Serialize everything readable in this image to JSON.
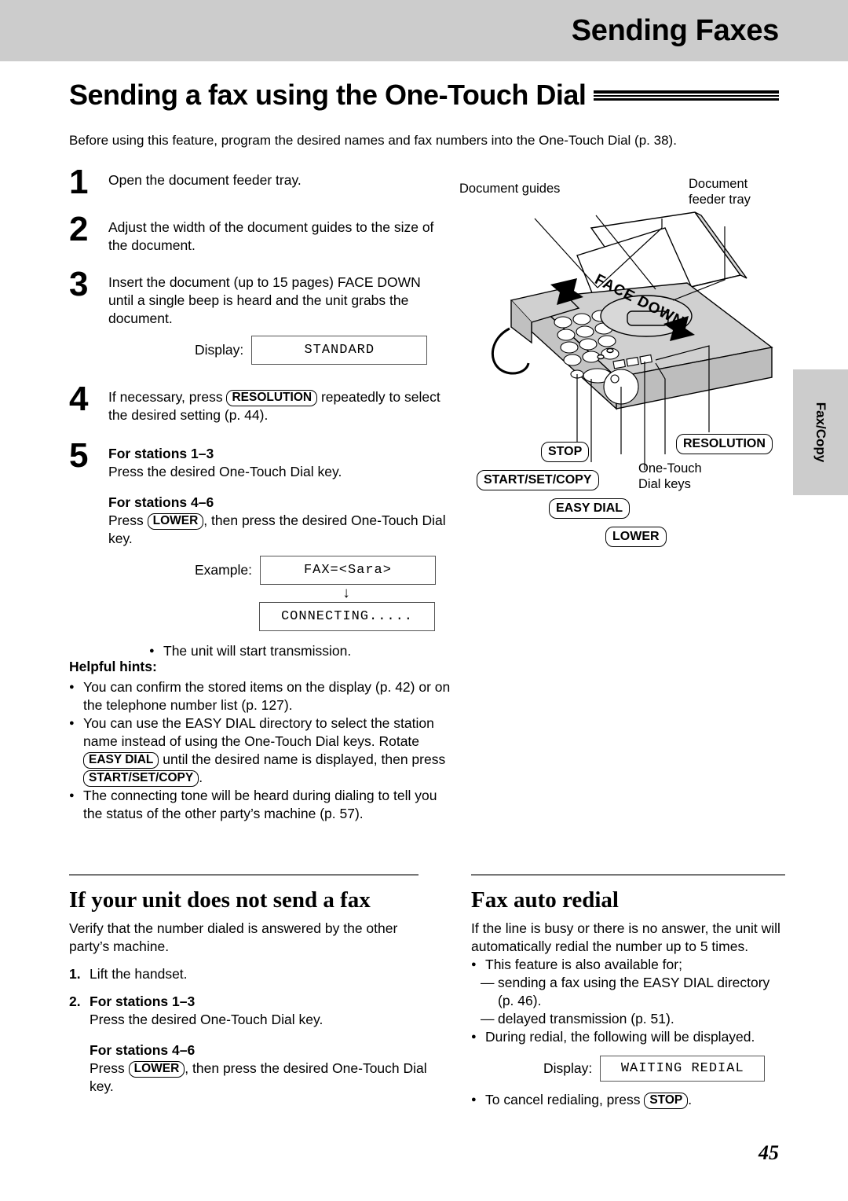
{
  "header": {
    "section_title": "Sending Faxes"
  },
  "title": {
    "main": "Sending a fax using the One-Touch Dial"
  },
  "intro": "Before using this feature, program the desired names and fax numbers into the One-Touch Dial (p. 38).",
  "steps": [
    {
      "num": "1",
      "text": "Open the document feeder tray."
    },
    {
      "num": "2",
      "text": "Adjust the width of the document guides to the size of the document."
    },
    {
      "num": "3",
      "text": "Insert the document (up to 15 pages) FACE DOWN until a single beep is heard and the unit grabs the document."
    },
    {
      "num": "4",
      "pre": "If necessary, press",
      "key": "RESOLUTION",
      "post": "repeatedly to select the desired setting (p. 44)."
    },
    {
      "num": "5"
    }
  ],
  "step3_display": {
    "label": "Display:",
    "value": "STANDARD"
  },
  "step5": {
    "stations_1_3_head": "For stations 1–3",
    "stations_1_3_text": "Press the desired One-Touch Dial key.",
    "stations_4_6_head": "For stations 4–6",
    "stations_4_6_pre": "Press",
    "stations_4_6_key": "LOWER",
    "stations_4_6_post": ", then press the desired One-Touch Dial key.",
    "example_label": "Example:",
    "example_value": "FAX=<Sara>",
    "arrow": "↓",
    "result_value": "CONNECTING.....",
    "note": "The unit will start transmission."
  },
  "hints": {
    "title": "Helpful hints:",
    "item1": "You can confirm the stored items on the display (p. 42) or on the telephone number list (p. 127).",
    "item2_a": "You can use the EASY DIAL directory to select the station name instead of using the One-Touch Dial keys. Rotate",
    "item2_key1": "EASY DIAL",
    "item2_b": "until the desired name is displayed, then press",
    "item2_key2": "START/SET/COPY",
    "item2_c": ".",
    "item3": "The connecting tone will be heard during dialing to tell you the status of the other party’s machine (p. 57)."
  },
  "illustration": {
    "label_document_guides": "Document guides",
    "label_feeder_tray_l1": "Document",
    "label_feeder_tray_l2": "feeder tray",
    "label_face_down": "FACE DOWN",
    "key_stop": "STOP",
    "key_start_set_copy": "START/SET/COPY",
    "key_easy_dial": "EASY DIAL",
    "key_lower": "LOWER",
    "key_resolution": "RESOLUTION",
    "label_one_touch_l1": "One-Touch",
    "label_one_touch_l2": "Dial keys"
  },
  "side_tab": {
    "label": "Fax/Copy"
  },
  "left_column": {
    "heading": "If your unit does not send a fax",
    "body": "Verify that the number dialed is answered by the other party’s machine.",
    "item1_num": "1.",
    "item1_text": "Lift the handset.",
    "item2_num": "2.",
    "item2_head1": "For stations 1–3",
    "item2_text1": "Press the desired One-Touch Dial key.",
    "item2_head2": "For stations 4–6",
    "item2_pre": "Press",
    "item2_key": "LOWER",
    "item2_post": ", then press the desired One-Touch Dial key."
  },
  "right_column": {
    "heading": "Fax auto redial",
    "body": "If the line is busy or there is no answer, the unit will automatically redial the number up to 5 times.",
    "bullet1": "This feature is also available for;",
    "dash1": "sending a fax using the EASY DIAL directory (p. 46).",
    "dash2": "delayed transmission (p. 51).",
    "bullet2": "During redial, the following will be displayed.",
    "display_label": "Display:",
    "display_value": "WAITING REDIAL",
    "bullet3_pre": "To cancel redialing, press",
    "bullet3_key": "STOP",
    "bullet3_post": "."
  },
  "page_number": "45",
  "colors": {
    "band": "#cccccc",
    "rule": "#777777"
  }
}
